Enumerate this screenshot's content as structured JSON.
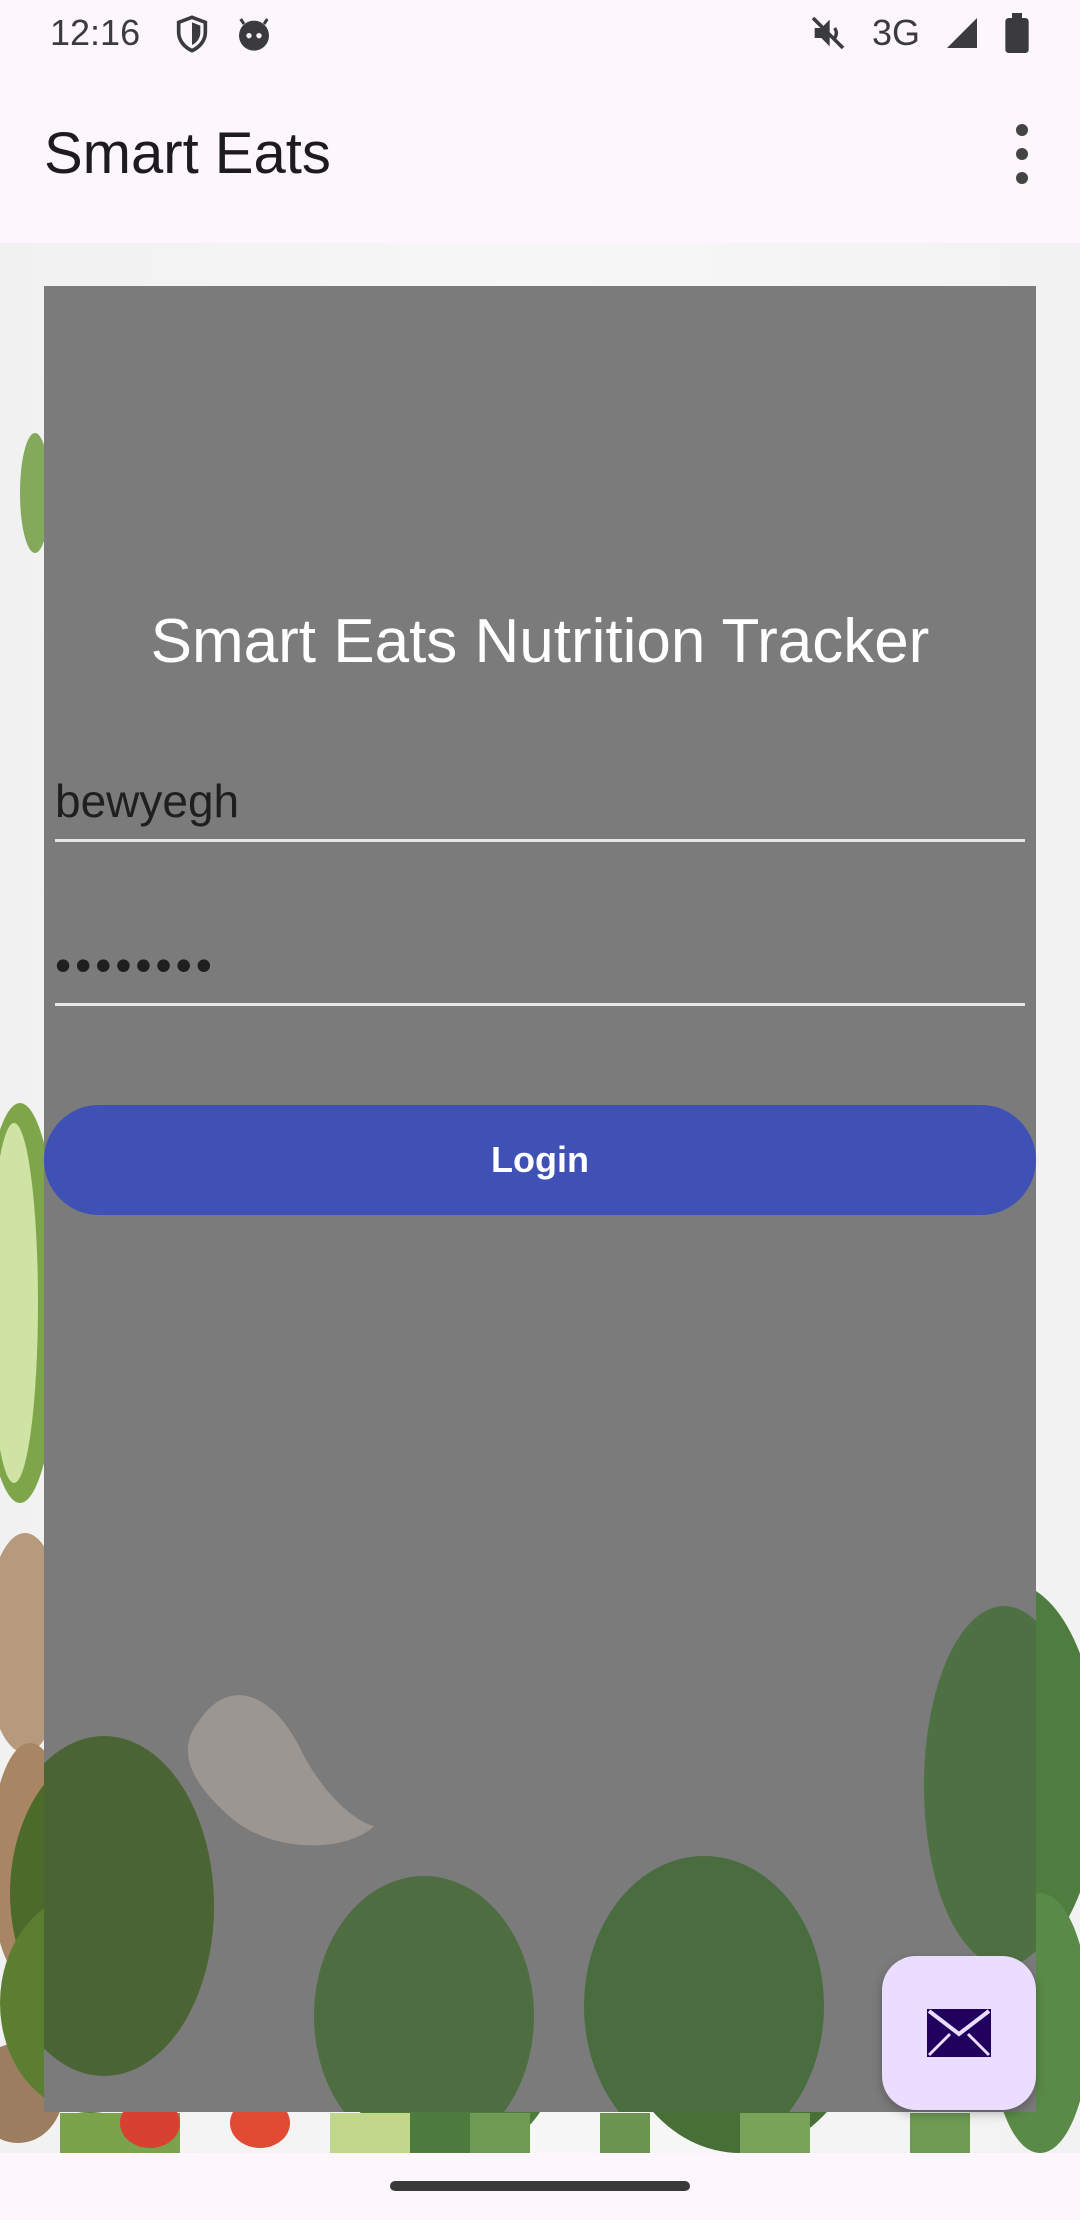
{
  "status_bar": {
    "time": "12:16",
    "network": "3G",
    "icons": [
      "shield-icon",
      "android-face-icon",
      "mute-icon",
      "signal-icon",
      "battery-icon"
    ]
  },
  "app_bar": {
    "title": "Smart Eats",
    "menu_icon": "more-vertical-icon"
  },
  "login_form": {
    "title": "Smart Eats Nutrition Tracker",
    "username_value": "bewyegh",
    "password_value": "••••••••",
    "login_label": "Login"
  },
  "fab": {
    "icon": "mail-icon"
  },
  "colors": {
    "background": "#fdf7fd",
    "card": "#7b7b7b",
    "button": "#3f51b5",
    "fab": "#eaddff",
    "fab_icon": "#21005d"
  }
}
